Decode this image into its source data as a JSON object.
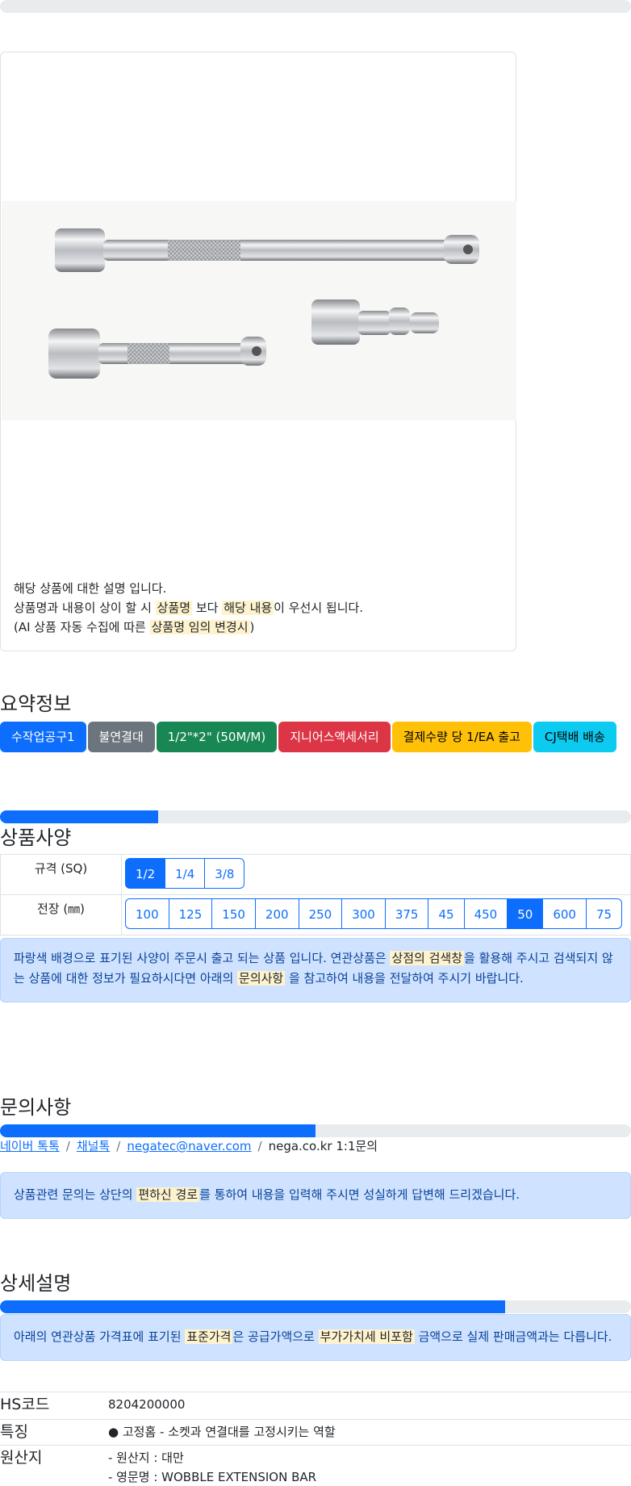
{
  "product": {
    "desc_line1": "해당 상품에 대한 설명 입니다.",
    "desc_line2_a": "상품명과 내용이 상이 할 시 ",
    "desc_line2_hl1": "상품명",
    "desc_line2_b": " 보다 ",
    "desc_line2_hl2": "해당 내용",
    "desc_line2_c": "이 우선시 됩니다.",
    "desc_line3_a": "(AI 상품 자동 수집에 따른 ",
    "desc_line3_hl": "상품명 임의 변경시",
    "desc_line3_b": ")"
  },
  "summary": {
    "title": "요약정보",
    "badges": [
      "수작업공구1",
      "불연결대",
      "1/2\"*2\" (50M/M)",
      "지니어스액세서리",
      "결제수량 당 1/EA 출고",
      "CJ택배 배송"
    ]
  },
  "spec": {
    "title": "상품사양",
    "progress": 0.25,
    "rows": [
      {
        "label": "규격 (SQ)",
        "options": [
          "1/2",
          "1/4",
          "3/8"
        ],
        "selected": 0
      },
      {
        "label": "전장 (㎜)",
        "options": [
          "100",
          "125",
          "150",
          "200",
          "250",
          "300",
          "375",
          "45",
          "450",
          "50",
          "600",
          "75"
        ],
        "selected": 9
      }
    ],
    "notice_a": "파랑색 배경으로 표기된 사양이 주문시 출고 되는 상품 입니다. 연관상품은 ",
    "notice_hl1": "상점의 검색창",
    "notice_b": "을 활용해 주시고 검색되지 않는 상품에 대한 정보가 필요하시다면 아래의 ",
    "notice_hl2": "문의사항",
    "notice_c": " 을 참고하여 내용을 전달하여 주시기 바랍니다."
  },
  "inquiry": {
    "title": "문의사항",
    "progress": 0.5,
    "links": [
      "네이버 톡톡",
      "채널톡",
      "negatec@naver.com"
    ],
    "separator": "/",
    "plain": "nega.co.kr 1:1문의",
    "notice_a": "상품관련 문의는 상단의 ",
    "notice_hl": "편하신 경로",
    "notice_b": "를 통하여 내용을 입력해 주시면 성실하게 답변해 드리겠습니다."
  },
  "detail": {
    "title": "상세설명",
    "progress": 0.8,
    "notice_a": "아래의 연관상품 가격표에 표기된 ",
    "notice_hl1": "표준가격",
    "notice_b": "은 공급가액으로 ",
    "notice_hl2": "부가가치세 비포함",
    "notice_c": " 금액으로 실제 판매금액과는 다릅니다.",
    "rows": [
      {
        "key": "HS코드",
        "lines": [
          "8204200000"
        ]
      },
      {
        "key": "특징",
        "lines": [
          "● 고정홈 - 소켓과 연결대를 고정시키는 역할"
        ]
      },
      {
        "key": "원산지",
        "lines": [
          "- 원산지 : 대만",
          "- 영문명 : WOBBLE EXTENSION BAR"
        ]
      }
    ]
  }
}
